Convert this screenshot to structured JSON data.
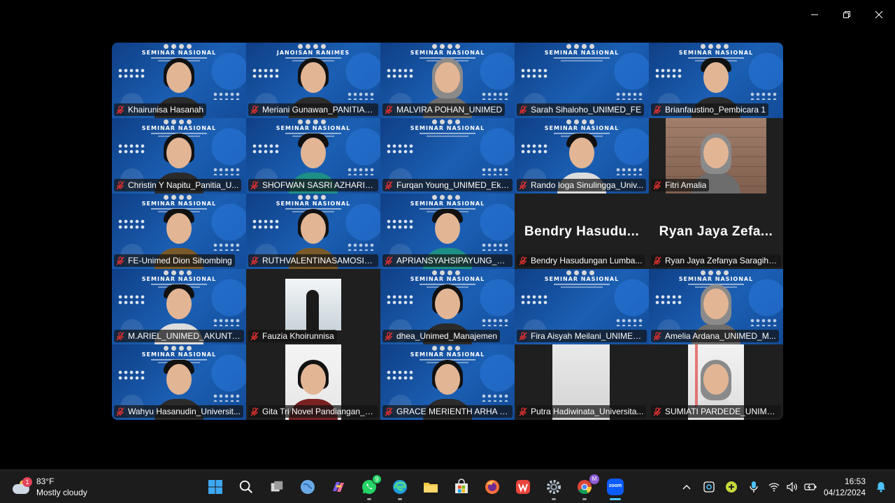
{
  "window": {
    "controls": [
      "minimize",
      "restore",
      "close"
    ]
  },
  "gallery": {
    "seminar_banner": "SEMINAR NASIONAL",
    "mirrored_banner": "JANOISAN RANIMES",
    "tiles": [
      {
        "name": "Khairunisa Hasanah",
        "bg": "seminar",
        "person": "long"
      },
      {
        "name": "Meriani Gunawan_PANITIA_UNI...",
        "bg": "seminar",
        "person": "long",
        "active": true,
        "mirrored": true
      },
      {
        "name": "MALVIRA POHAN_UNIMED",
        "bg": "seminar",
        "person": "hijab"
      },
      {
        "name": "Sarah Sihaloho_UNIMED_FE",
        "bg": "seminar",
        "person": "none"
      },
      {
        "name": "Brianfaustino_Pembicara 1",
        "bg": "seminar",
        "person": "short"
      },
      {
        "name": "Christin Y Napitu_Panitia_U...",
        "bg": "seminar",
        "person": "long"
      },
      {
        "name": "SHOFWAN SASRI AZHARI_U...",
        "bg": "seminar",
        "person": "short green"
      },
      {
        "name": "Furqan Young_UNIMED_Eko...",
        "bg": "seminar",
        "person": "none"
      },
      {
        "name": "Rando Ioga Sinulingga_Univ...",
        "bg": "seminar",
        "person": "short white"
      },
      {
        "name": "Fitri Amalia",
        "bg": "room",
        "person": "hijab"
      },
      {
        "name": "FE-Unimed Dion Sihombing",
        "bg": "seminar",
        "person": "short batik"
      },
      {
        "name": "RUTHVALENTINASAMOSIR_...",
        "bg": "seminar",
        "person": "long batik"
      },
      {
        "name": "APRIANSYAHSIPAYUNG_KET...",
        "bg": "seminar",
        "person": "short green"
      },
      {
        "name": "Bendry Hasudungan Lumba...",
        "bg": "dark",
        "person": "none",
        "big": "Bendry Hasudu..."
      },
      {
        "name": "Ryan Jaya Zefanya Saragih_...",
        "bg": "dark",
        "person": "none",
        "big": "Ryan Jaya Zefa..."
      },
      {
        "name": "M.ARIEL_UNIMED_AKUNTA...",
        "bg": "seminar",
        "person": "short white"
      },
      {
        "name": "Fauzia Khoirunnisa",
        "bg": "window",
        "person": "none"
      },
      {
        "name": "dhea_Unimed_Manajemen",
        "bg": "seminar",
        "person": "long"
      },
      {
        "name": "Fira Aisyah Meilani_UNIMED...",
        "bg": "seminar",
        "person": "none"
      },
      {
        "name": "Amelia Ardana_UNIMED_M...",
        "bg": "seminar",
        "person": "hijab"
      },
      {
        "name": "Wahyu Hasanudin_Universit...",
        "bg": "seminar",
        "person": "short"
      },
      {
        "name": "Gita Tri Novel Pandiangan_U...",
        "bg": "light",
        "person": "long red"
      },
      {
        "name": "GRACE MERIENTH ARHA SIL...",
        "bg": "seminar",
        "person": "long"
      },
      {
        "name": "Putra Hadiwinata_Universita...",
        "bg": "wall",
        "person": "none"
      },
      {
        "name": "SUMIATI PARDEDE_UNIMED...",
        "bg": "board",
        "person": "hijab white"
      }
    ]
  },
  "taskbar": {
    "weather": {
      "temp": "83°F",
      "desc": "Mostly cloudy",
      "badge": "1"
    },
    "apps": [
      {
        "icon": "windows-start-icon",
        "indicator": "none"
      },
      {
        "icon": "search-icon",
        "indicator": "none"
      },
      {
        "icon": "task-view-icon",
        "indicator": "none"
      },
      {
        "icon": "globe-icon",
        "indicator": "none"
      },
      {
        "icon": "copilot-icon",
        "indicator": "none"
      },
      {
        "icon": "whatsapp-icon",
        "indicator": "dot",
        "count": "9"
      },
      {
        "icon": "edge-icon",
        "indicator": "dot"
      },
      {
        "icon": "file-explorer-icon",
        "indicator": "none"
      },
      {
        "icon": "store-icon",
        "indicator": "none"
      },
      {
        "icon": "firefox-icon",
        "indicator": "none"
      },
      {
        "icon": "wps-icon",
        "indicator": "none"
      },
      {
        "icon": "settings-icon",
        "indicator": "dot"
      },
      {
        "icon": "chrome-icon",
        "indicator": "dot"
      },
      {
        "icon": "zoom-icon",
        "indicator": "active"
      }
    ],
    "zoom_label": "zoom",
    "chrome_profile": "M",
    "clock": {
      "time": "16:53",
      "date": "04/12/2024"
    }
  },
  "colors": {
    "active_speaker": "#2fd37a",
    "muted_mic": "#e0312f",
    "accent": "#4cc2ff"
  }
}
